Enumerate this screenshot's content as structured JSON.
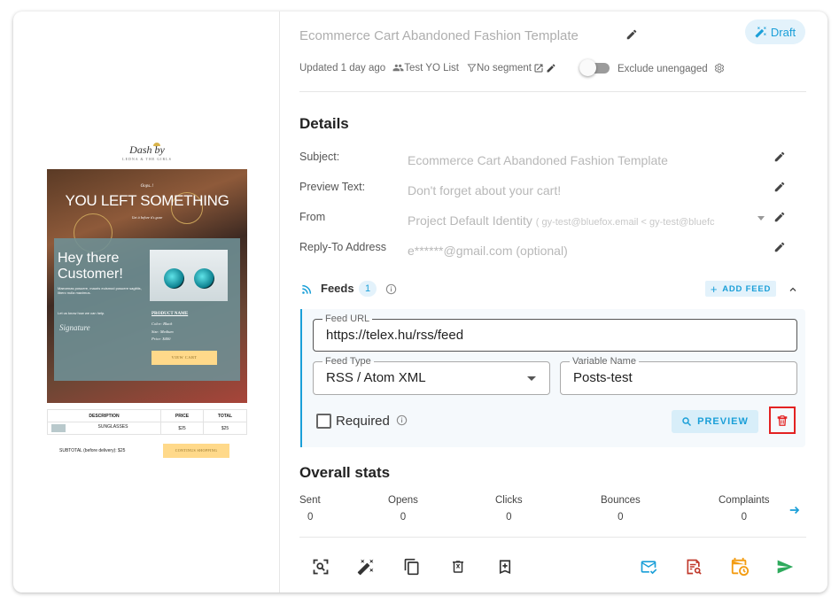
{
  "email_preview": {
    "brand_line1": "Dash by",
    "brand_line2": "LEDNA & THE GIRLS",
    "oops": "Oops..!",
    "headline": "YOU LEFT SOMETHING",
    "subheadline": "Get it before it's gone",
    "greeting": "Hey there Customer!",
    "body_text": "Maecenas posuere, mauris euismod posuere sagittis, libero nulla maximus.",
    "let_us_know": "Let us know how we can help.",
    "signature": "Signature",
    "product_name": "PRODUCT NAME",
    "color_line": "Color: Black",
    "size_line": "Size: Medium",
    "price_line": "Price: $400",
    "view_cart": "VIEW CART",
    "table_headers": [
      "DESCRIPTION",
      "PRICE",
      "TOTAL"
    ],
    "table_row": {
      "item": "SUNGLASSES",
      "price": "$25",
      "total": "$25"
    },
    "subtotal": "SUBTOTAL (before delivery): $25",
    "continue": "CONTINUS SHOPPING"
  },
  "header": {
    "title": "Ecommerce Cart Abandoned Fashion Template",
    "status": "Draft",
    "updated": "Updated 1 day ago",
    "list": "Test YO List",
    "segment": "No segment",
    "exclude_label": "Exclude unengaged",
    "exclude_on": false
  },
  "details": {
    "heading": "Details",
    "rows": [
      {
        "label": "Subject:",
        "value": "Ecommerce Cart Abandoned Fashion Template",
        "extra": ""
      },
      {
        "label": "Preview Text:",
        "value": "Don't forget about your cart!",
        "extra": ""
      },
      {
        "label": "From",
        "value": "Project Default Identity",
        "extra": "( gy-test@bluefox.email < gy-test@bluefc"
      },
      {
        "label": "Reply-To Address",
        "value": "e******@gmail.com (optional)",
        "extra": ""
      }
    ]
  },
  "feeds": {
    "label": "Feeds",
    "count": "1",
    "add_label": "ADD FEED",
    "feed_url_label": "Feed URL",
    "feed_url": "https://telex.hu/rss/feed",
    "feed_type_label": "Feed Type",
    "feed_type": "RSS / Atom XML",
    "variable_label": "Variable Name",
    "variable": "Posts-test",
    "required_label": "Required",
    "preview_label": "PREVIEW"
  },
  "stats": {
    "heading": "Overall stats",
    "items": [
      {
        "label": "Sent",
        "value": "0"
      },
      {
        "label": "Opens",
        "value": "0"
      },
      {
        "label": "Clicks",
        "value": "0"
      },
      {
        "label": "Bounces",
        "value": "0"
      },
      {
        "label": "Complaints",
        "value": "0"
      }
    ]
  },
  "colors": {
    "accent": "#1a9fd8",
    "danger": "#e32222",
    "warning": "#f39c12",
    "success": "#2eaa5c",
    "error_red": "#c0392b"
  }
}
